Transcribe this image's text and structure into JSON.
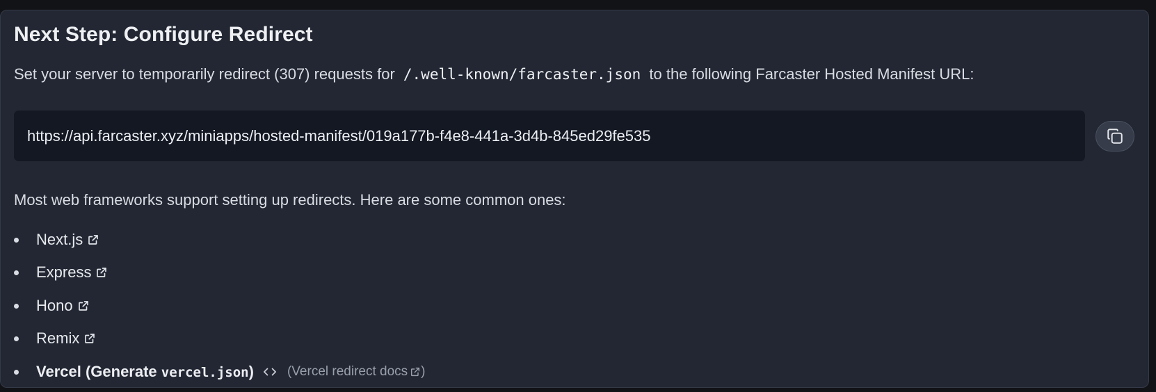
{
  "section": {
    "title": "Next Step: Configure Redirect",
    "intro_before": "Set your server to temporarily redirect (307) requests for",
    "intro_path": "/.well-known/farcaster.json",
    "intro_after": "to the following Farcaster Hosted Manifest URL:"
  },
  "manifest": {
    "url": "https://api.farcaster.xyz/miniapps/hosted-manifest/019a177b-f4e8-441a-3d4b-845ed29fe535",
    "copy_icon": "copy-icon"
  },
  "frameworks": {
    "description": "Most web frameworks support setting up redirects. Here are some common ones:",
    "items": [
      {
        "label": "Next.js",
        "icon": "external-link-icon"
      },
      {
        "label": "Express",
        "icon": "external-link-icon"
      },
      {
        "label": "Hono",
        "icon": "external-link-icon"
      },
      {
        "label": "Remix",
        "icon": "external-link-icon"
      }
    ],
    "vercel": {
      "generate_prefix": "Vercel (Generate",
      "generate_file": "vercel.json",
      "generate_suffix": ")",
      "code_icon": "code-icon",
      "docs_open": "(",
      "docs_label": "Vercel redirect docs",
      "docs_close": ")"
    }
  }
}
